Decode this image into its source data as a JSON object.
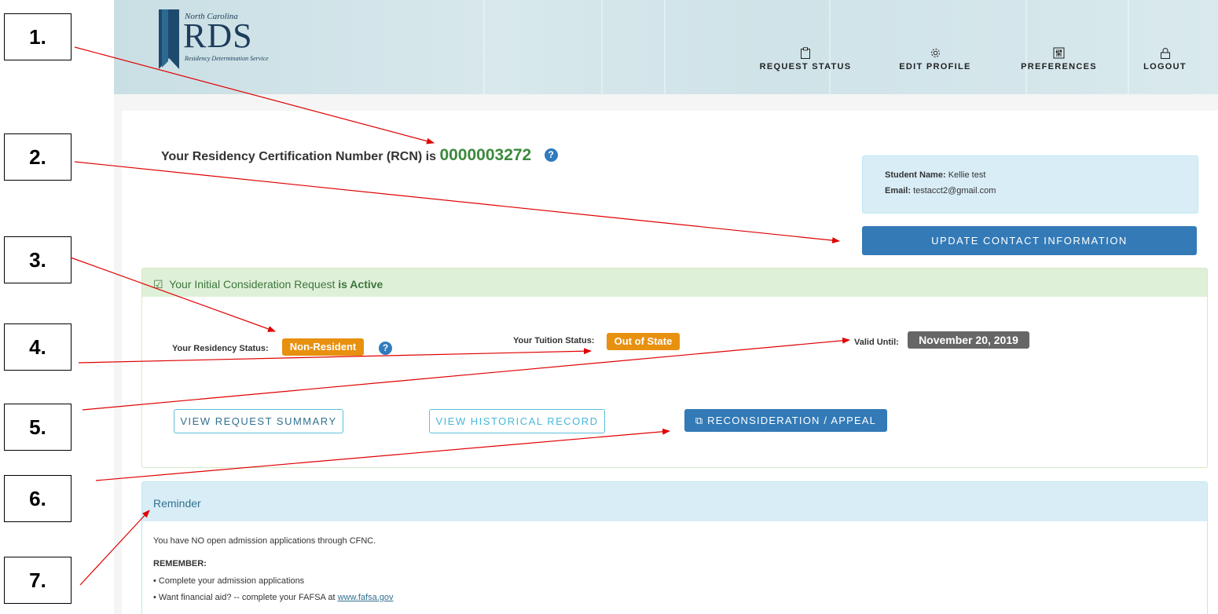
{
  "header": {
    "logo": {
      "state": "North Carolina",
      "title": "RDS",
      "subtitle": "Residency Determination Service"
    },
    "nav": [
      {
        "label": "REQUEST STATUS",
        "icon": "clipboard-icon"
      },
      {
        "label": "EDIT PROFILE",
        "icon": "gear-icon"
      },
      {
        "label": "PREFERENCES",
        "icon": "sliders-icon"
      },
      {
        "label": "LOGOUT",
        "icon": "lock-icon"
      }
    ]
  },
  "rcn": {
    "prefix": "Your Residency Certification Number (RCN) is",
    "number": "0000003272",
    "help": "?"
  },
  "student": {
    "name_label": "Student Name:",
    "name": "Kellie test",
    "email_label": "Email:",
    "email": "testacct2@gmail.com"
  },
  "update_button": "UPDATE CONTACT INFORMATION",
  "request": {
    "heading_icon": "☑",
    "heading": "Your Initial Consideration Request",
    "heading_status": "is Active",
    "residency_label": "Your Residency Status:",
    "residency_value": "Non-Resident",
    "help": "?",
    "tuition_label": "Your Tuition Status:",
    "tuition_value": "Out of State",
    "valid_label": "Valid Until:",
    "valid_value": "November 20, 2019",
    "buttons": {
      "summary": "VIEW REQUEST SUMMARY",
      "history": "VIEW HISTORICAL RECORD",
      "recon_icon": "⧉",
      "recon": "RECONSIDERATION / APPEAL"
    }
  },
  "reminder": {
    "heading": "Reminder",
    "line1": "You have NO open admission applications through CFNC.",
    "remember": "REMEMBER:",
    "bullet1": "Complete your admission applications",
    "bullet2_text": "Want financial aid? -- complete your FAFSA at",
    "bullet2_link": "www.fafsa.gov"
  },
  "callouts": [
    "1.",
    "2.",
    "3.",
    "4.",
    "5.",
    "6.",
    "7."
  ],
  "colors": {
    "primary": "#337ab7",
    "rcn_green": "#3c8a3c",
    "status_orange": "#e8900f",
    "date_gray": "#666666",
    "success_bg": "#dff0d8",
    "info_bg": "#d9edf7",
    "arrow_red": "#e00000"
  }
}
